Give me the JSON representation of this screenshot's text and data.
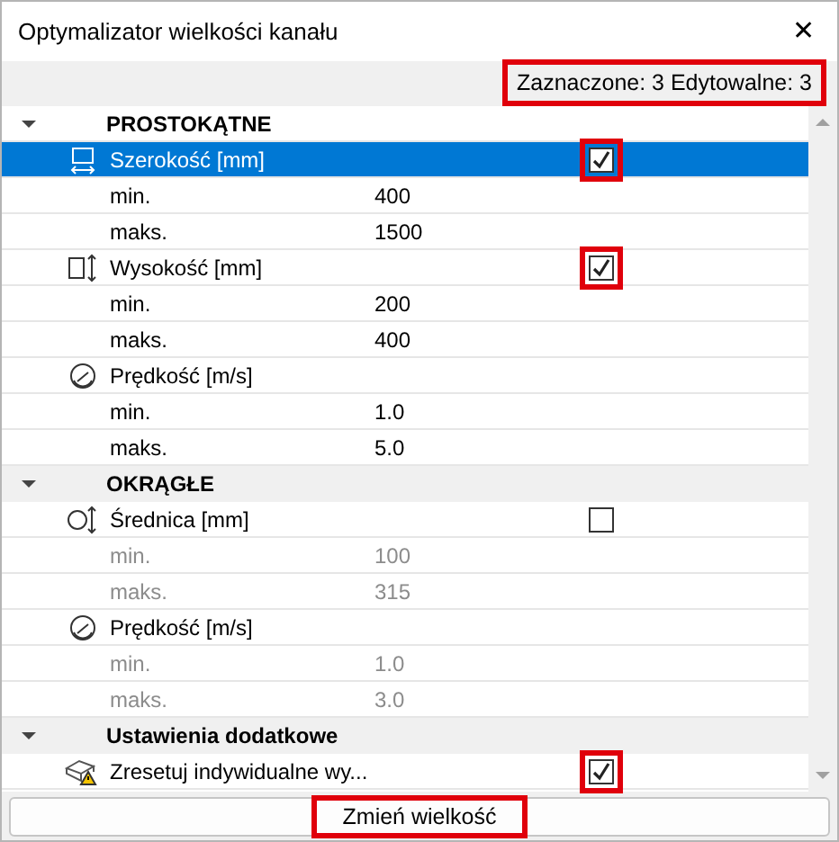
{
  "window": {
    "title": "Optymalizator wielkości kanału",
    "close": "✕"
  },
  "status": {
    "text": "Zaznaczone: 3 Edytowalne: 3",
    "highlighted": true
  },
  "groups": [
    {
      "title": "PROSTOKĄTNE",
      "expanded": true,
      "shaded": false,
      "properties": [
        {
          "kind": "width",
          "label": "Szerokość [mm]",
          "selected": true,
          "disabled": false,
          "checked": true,
          "highlighted": true,
          "values": [
            {
              "label": "min.",
              "value": "400"
            },
            {
              "label": "maks.",
              "value": "1500"
            }
          ]
        },
        {
          "kind": "height",
          "label": "Wysokość [mm]",
          "selected": false,
          "disabled": false,
          "checked": true,
          "highlighted": true,
          "values": [
            {
              "label": "min.",
              "value": "200"
            },
            {
              "label": "maks.",
              "value": "400"
            }
          ]
        },
        {
          "kind": "speed",
          "label": "Prędkość [m/s]",
          "selected": false,
          "disabled": false,
          "values": [
            {
              "label": "min.",
              "value": "1.0"
            },
            {
              "label": "maks.",
              "value": "5.0"
            }
          ]
        }
      ]
    },
    {
      "title": "OKRĄGŁE",
      "expanded": true,
      "shaded": true,
      "properties": [
        {
          "kind": "diameter",
          "label": "Średnica [mm]",
          "selected": false,
          "disabled": true,
          "checked": false,
          "highlighted": false,
          "values": [
            {
              "label": "min.",
              "value": "100"
            },
            {
              "label": "maks.",
              "value": "315"
            }
          ]
        },
        {
          "kind": "speed",
          "label": "Prędkość [m/s]",
          "selected": false,
          "disabled": true,
          "values": [
            {
              "label": "min.",
              "value": "1.0"
            },
            {
              "label": "maks.",
              "value": "3.0"
            }
          ]
        }
      ]
    },
    {
      "title": "Ustawienia dodatkowe",
      "expanded": true,
      "shaded": true,
      "properties": [
        {
          "kind": "reset",
          "label": "Zresetuj indywidualne wy...",
          "selected": false,
          "checked": true,
          "highlighted": true
        }
      ]
    }
  ],
  "button": {
    "label": "Zmień wielkość",
    "highlighted": true
  }
}
